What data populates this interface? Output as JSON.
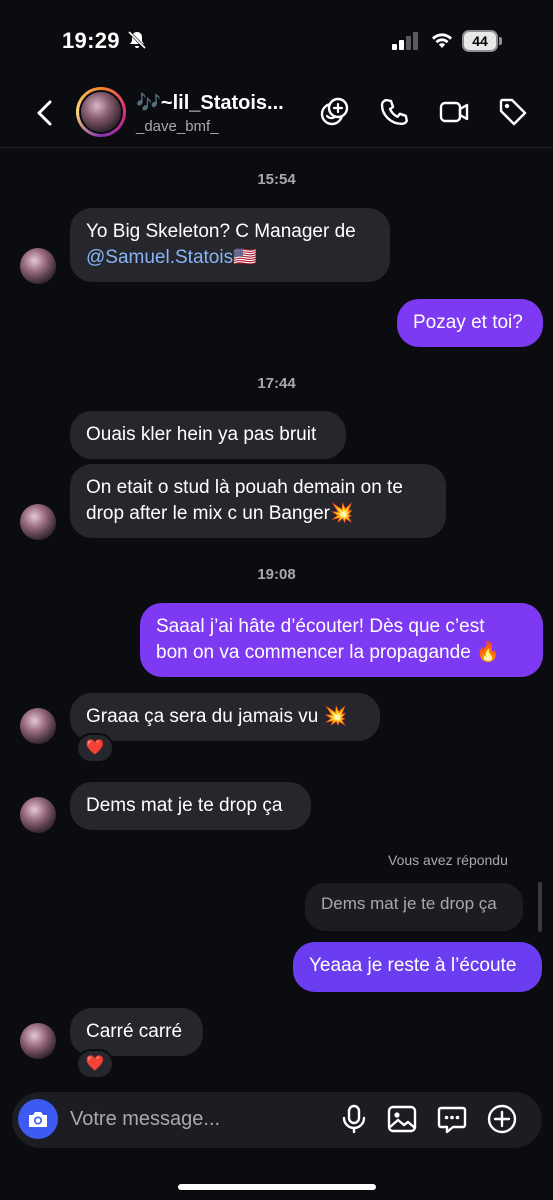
{
  "status_bar": {
    "time": "19:29",
    "battery": "44"
  },
  "header": {
    "contact_name": "🎶~lil_Statois...",
    "contact_username": "_dave_bmf_"
  },
  "messages": {
    "ts1": "15:54",
    "m1_line1": "Yo Big Skeleton? C Manager de",
    "m1_mention": "@Samuel.Statois",
    "m1_flag": "🇺🇸",
    "m2": "Pozay et toi?",
    "ts2": "17:44",
    "m3": "Ouais kler hein ya pas bruit",
    "m4_line1": "On etait o stud là pouah demain on te",
    "m4_line2": "drop after le mix c un Banger💥",
    "ts3": "19:08",
    "m5_line1": "Saaal j’ai hâte d’écouter! Dès que c’est",
    "m5_line2": "bon on va commencer la propagande 🔥",
    "m6": "Graaa ça sera du jamais vu 💥",
    "m6_reaction": "❤️",
    "m7": "Dems mat je te drop ça",
    "reply_label": "Vous avez répondu",
    "quoted": "Dems mat je te drop ça",
    "m8": "Yeaaa je reste à l’écoute",
    "m9": "Carré carré",
    "m9_reaction": "❤️"
  },
  "composer": {
    "placeholder": "Votre message..."
  },
  "icons": [
    "back-icon",
    "video-chat-icon",
    "phone-icon",
    "video-icon",
    "tag-icon",
    "camera-icon",
    "mic-icon",
    "image-icon",
    "sticker-icon",
    "plus-icon"
  ]
}
